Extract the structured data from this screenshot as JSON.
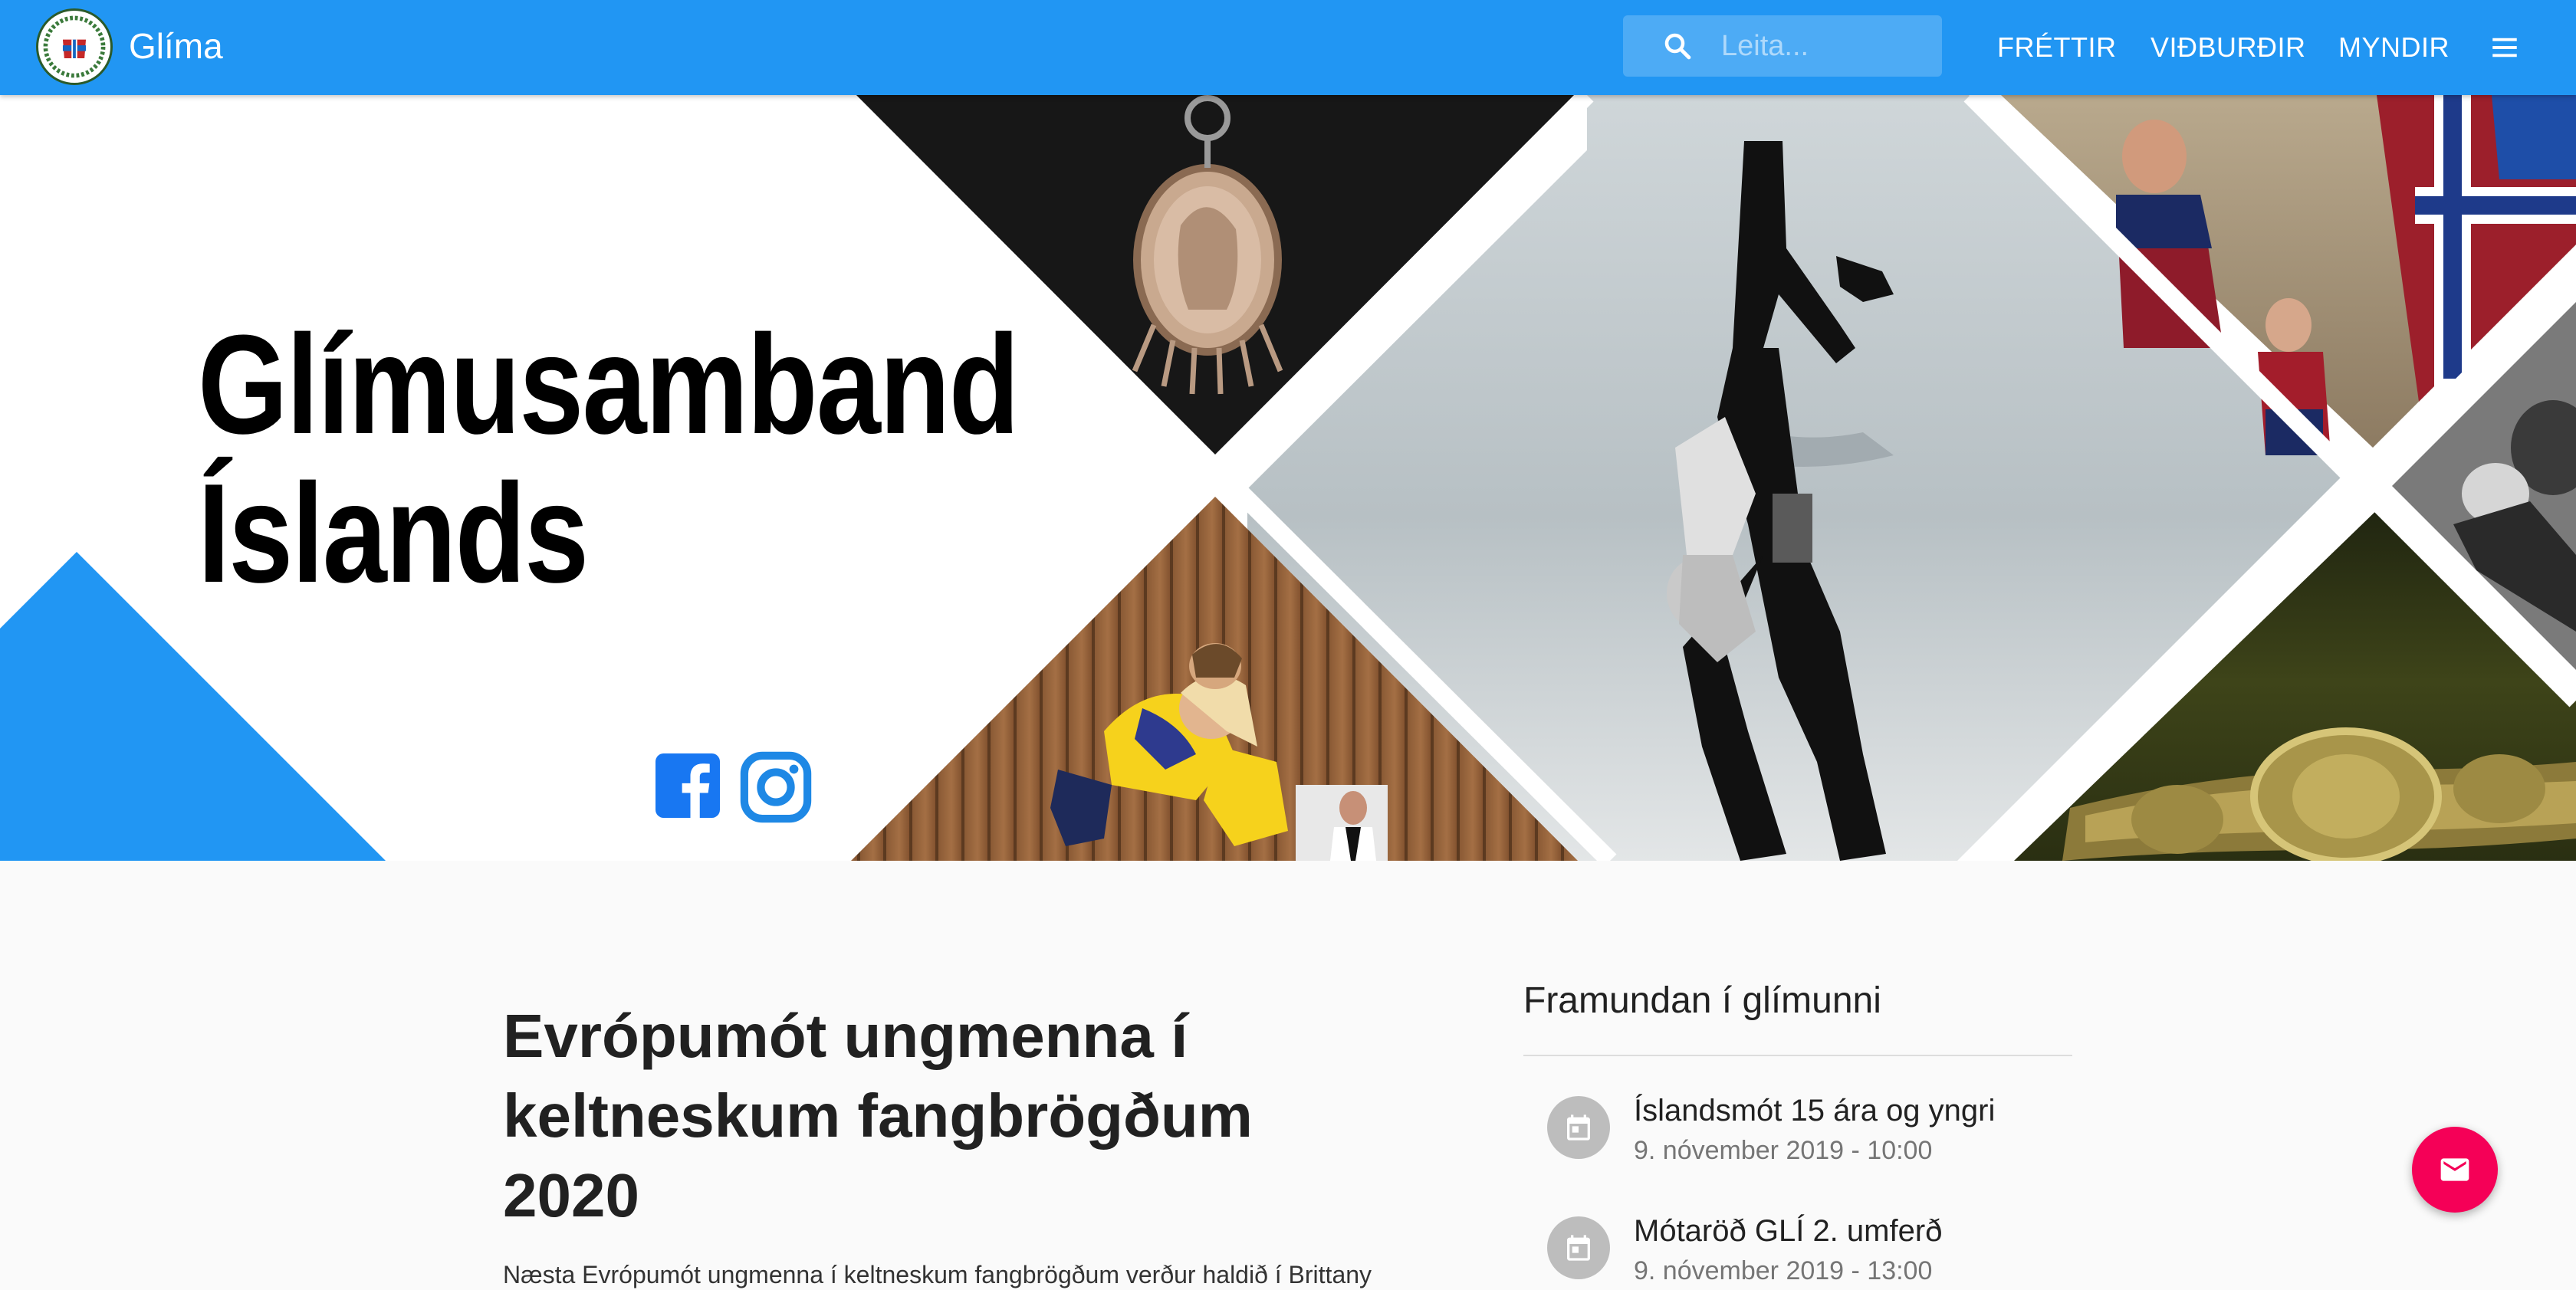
{
  "header": {
    "brand": "Glíma",
    "search_placeholder": "Leita...",
    "nav": [
      "FRÉTTIR",
      "VIÐBURÐIR",
      "MYNDIR"
    ]
  },
  "hero": {
    "title_line1": "Glímusamband",
    "title_line2": "Íslands"
  },
  "article": {
    "title_line1": "Evrópumót ungmenna í",
    "title_line2": "keltneskum fangbrögðum",
    "title_line3": "2020",
    "lead": "Næsta Evrópumót ungmenna í keltneskum fangbrögðum verður haldið í Brittany"
  },
  "sidebar": {
    "title": "Framundan í glímunni",
    "events": [
      {
        "title": "Íslandsmót 15 ára og yngri",
        "date": "9. nóvember 2019 - 10:00"
      },
      {
        "title": "Mótaröð GLÍ 2. umferð",
        "date": "9. nóvember 2019 - 13:00"
      }
    ]
  },
  "colors": {
    "primary": "#2196f3",
    "accent": "#f50057",
    "facebook": "#1877f2",
    "instagram": "#1e88e5"
  },
  "icons": [
    "search-icon",
    "menu-icon",
    "facebook-icon",
    "instagram-icon",
    "calendar-icon",
    "mail-icon"
  ]
}
